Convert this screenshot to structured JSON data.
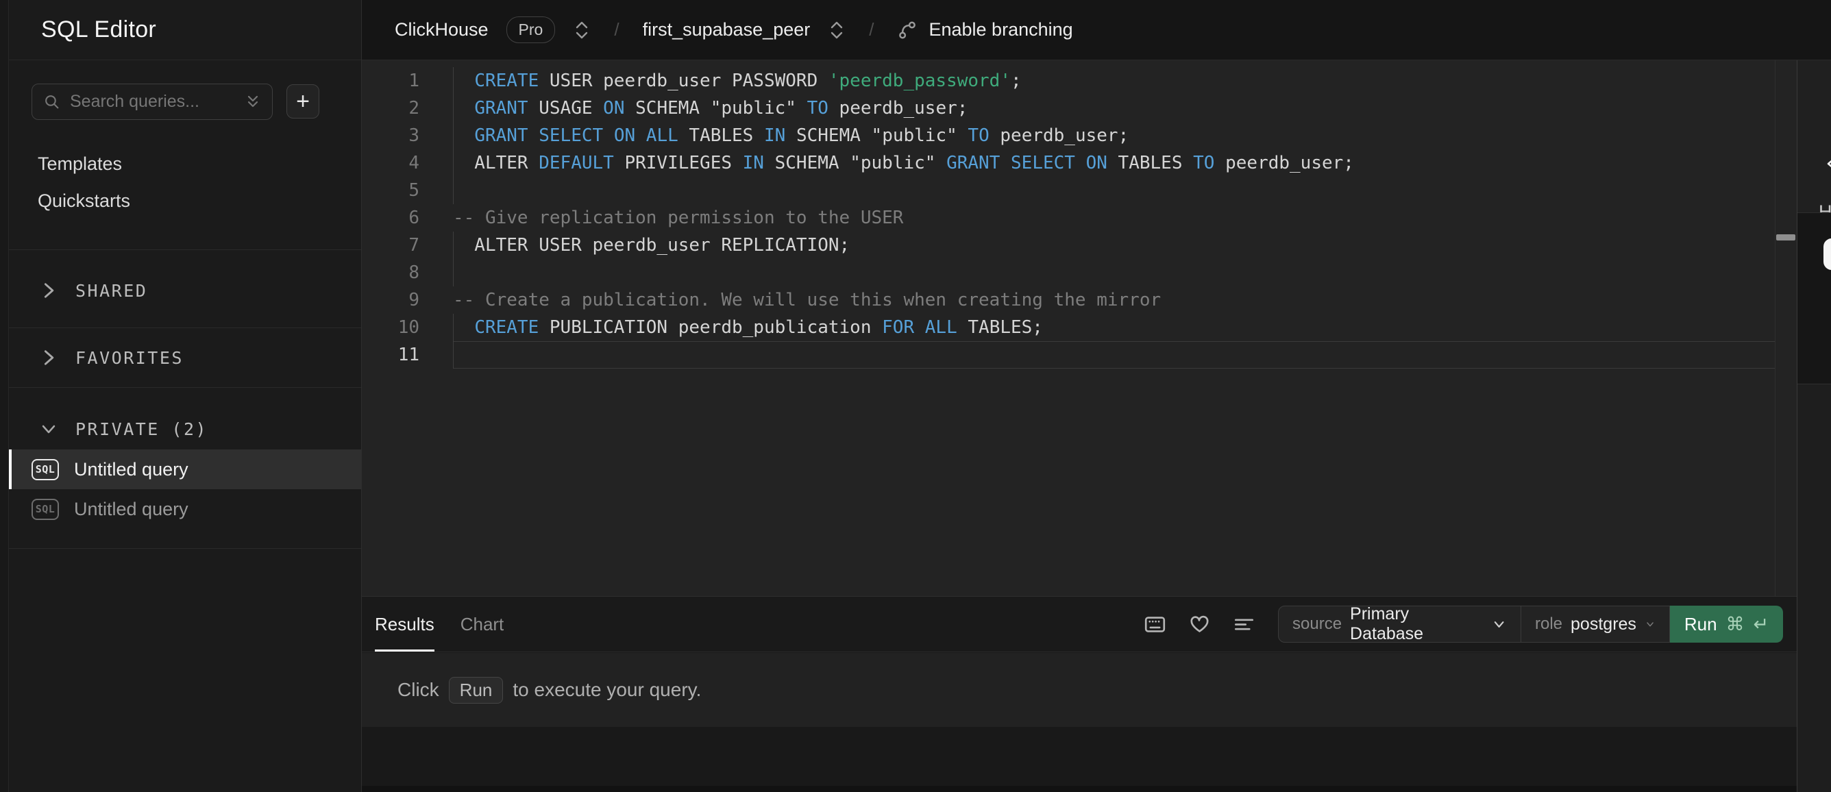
{
  "sidebar": {
    "title": "SQL Editor",
    "search": {
      "placeholder": "Search queries..."
    },
    "new_query_label": "+",
    "nav": [
      {
        "label": "Templates"
      },
      {
        "label": "Quickstarts"
      }
    ],
    "sections": [
      {
        "label": "SHARED",
        "collapsed": true
      },
      {
        "label": "FAVORITES",
        "collapsed": true
      },
      {
        "label": "PRIVATE (2)",
        "collapsed": false
      }
    ],
    "badge": "SQL",
    "queries": [
      {
        "label": "Untitled query",
        "selected": true
      },
      {
        "label": "Untitled query",
        "selected": false
      }
    ]
  },
  "topbar": {
    "org": "ClickHouse",
    "plan_badge": "Pro",
    "separator": "/",
    "project": "first_supabase_peer",
    "branching_label": "Enable branching"
  },
  "editor": {
    "lines": [
      {
        "n": "1",
        "guide": true,
        "current": false,
        "tokens": [
          {
            "t": "pl",
            "v": "  "
          },
          {
            "t": "kw",
            "v": "CREATE"
          },
          {
            "t": "pl",
            "v": " USER peerdb_user PASSWORD "
          },
          {
            "t": "str",
            "v": "'peerdb_password'"
          },
          {
            "t": "pl",
            "v": ";"
          }
        ]
      },
      {
        "n": "2",
        "guide": true,
        "current": false,
        "tokens": [
          {
            "t": "pl",
            "v": "  "
          },
          {
            "t": "kw",
            "v": "GRANT"
          },
          {
            "t": "pl",
            "v": " USAGE "
          },
          {
            "t": "kw",
            "v": "ON"
          },
          {
            "t": "pl",
            "v": " SCHEMA \"public\" "
          },
          {
            "t": "kw",
            "v": "TO"
          },
          {
            "t": "pl",
            "v": " peerdb_user;"
          }
        ]
      },
      {
        "n": "3",
        "guide": true,
        "current": false,
        "tokens": [
          {
            "t": "pl",
            "v": "  "
          },
          {
            "t": "kw",
            "v": "GRANT"
          },
          {
            "t": "pl",
            "v": " "
          },
          {
            "t": "kw",
            "v": "SELECT"
          },
          {
            "t": "pl",
            "v": " "
          },
          {
            "t": "kw",
            "v": "ON"
          },
          {
            "t": "pl",
            "v": " "
          },
          {
            "t": "kw",
            "v": "ALL"
          },
          {
            "t": "pl",
            "v": " TABLES "
          },
          {
            "t": "kw",
            "v": "IN"
          },
          {
            "t": "pl",
            "v": " SCHEMA \"public\" "
          },
          {
            "t": "kw",
            "v": "TO"
          },
          {
            "t": "pl",
            "v": " peerdb_user;"
          }
        ]
      },
      {
        "n": "4",
        "guide": true,
        "current": false,
        "tokens": [
          {
            "t": "pl",
            "v": "  ALTER "
          },
          {
            "t": "kw",
            "v": "DEFAULT"
          },
          {
            "t": "pl",
            "v": " PRIVILEGES "
          },
          {
            "t": "kw",
            "v": "IN"
          },
          {
            "t": "pl",
            "v": " SCHEMA \"public\" "
          },
          {
            "t": "kw",
            "v": "GRANT"
          },
          {
            "t": "pl",
            "v": " "
          },
          {
            "t": "kw",
            "v": "SELECT"
          },
          {
            "t": "pl",
            "v": " "
          },
          {
            "t": "kw",
            "v": "ON"
          },
          {
            "t": "pl",
            "v": " TABLES "
          },
          {
            "t": "kw",
            "v": "TO"
          },
          {
            "t": "pl",
            "v": " peerdb_user;"
          }
        ]
      },
      {
        "n": "5",
        "guide": true,
        "current": false,
        "tokens": []
      },
      {
        "n": "6",
        "guide": false,
        "current": false,
        "tokens": [
          {
            "t": "com",
            "v": "-- Give replication permission to the USER"
          }
        ]
      },
      {
        "n": "7",
        "guide": true,
        "current": false,
        "tokens": [
          {
            "t": "pl",
            "v": "  ALTER USER peerdb_user REPLICATION;"
          }
        ]
      },
      {
        "n": "8",
        "guide": true,
        "current": false,
        "tokens": []
      },
      {
        "n": "9",
        "guide": false,
        "current": false,
        "tokens": [
          {
            "t": "com",
            "v": "-- Create a publication. We will use this when creating the mirror"
          }
        ]
      },
      {
        "n": "10",
        "guide": true,
        "current": false,
        "tokens": [
          {
            "t": "pl",
            "v": "  "
          },
          {
            "t": "kw",
            "v": "CREATE"
          },
          {
            "t": "pl",
            "v": " PUBLICATION peerdb_publication "
          },
          {
            "t": "kw",
            "v": "FOR"
          },
          {
            "t": "pl",
            "v": " "
          },
          {
            "t": "kw",
            "v": "ALL"
          },
          {
            "t": "pl",
            "v": " TABLES;"
          }
        ]
      },
      {
        "n": "11",
        "guide": true,
        "current": true,
        "tokens": []
      }
    ]
  },
  "results": {
    "tabs": [
      {
        "label": "Results",
        "active": true
      },
      {
        "label": "Chart",
        "active": false
      }
    ],
    "source_label": "source",
    "source_value": "Primary Database",
    "role_label": "role",
    "role_value": "postgres",
    "run_label": "Run",
    "run_key_meta": "⌘",
    "run_key_enter": "↵",
    "empty_state": {
      "prefix": "Click",
      "kbd": "Run",
      "suffix": "to execute your query."
    }
  },
  "right_panel": {
    "fragments": [
      "H",
      "a"
    ]
  },
  "colors": {
    "keyword": "#56a0d8",
    "string": "#3fab7c",
    "comment": "#7d7d7d",
    "run_button": "#2f6e4e",
    "active_tab_underline": "#ffffff"
  }
}
